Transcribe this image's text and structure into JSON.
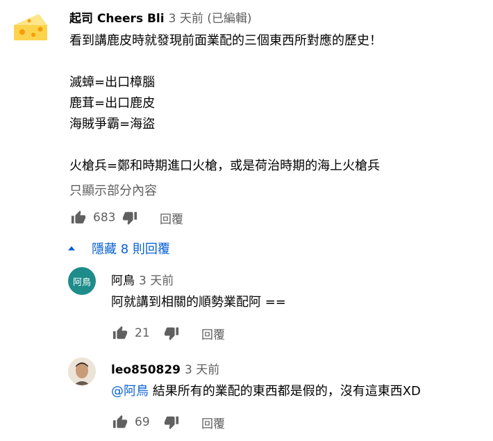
{
  "colors": {
    "link": "#065fd4",
    "secondary": "#606060",
    "text": "#030303",
    "avatar_teal": "#1e8c8a"
  },
  "main_comment": {
    "author": "起司 Cheers Bli",
    "time": "3 天前 (已編輯)",
    "lines": [
      "看到講鹿皮時就發現前面業配的三個東西所對應的歷史！",
      "",
      "滅蟑=出口樟腦",
      "鹿茸=出口鹿皮",
      "海賊爭霸=海盜",
      "",
      "火槍兵=鄭和時期進口火槍，或是荷治時期的海上火槍兵"
    ],
    "show_more": "只顯示部分內容",
    "likes": "683",
    "reply_label": "回覆",
    "avatar_icon": "cheese-icon"
  },
  "replies_toggle": {
    "label": "隱藏 8 則回覆"
  },
  "replies": [
    {
      "author": "阿鳥",
      "time": "3 天前",
      "avatar_text": "阿鳥",
      "mention": "",
      "text": "阿就講到相關的順勢業配阿 ==",
      "likes": "21",
      "reply_label": "回覆"
    },
    {
      "author": "leo850829",
      "time": "3 天前",
      "avatar_text": "",
      "mention": "@阿鳥",
      "text": " 結果所有的業配的東西都是假的，沒有這東西XD",
      "likes": "69",
      "reply_label": "回覆"
    }
  ]
}
